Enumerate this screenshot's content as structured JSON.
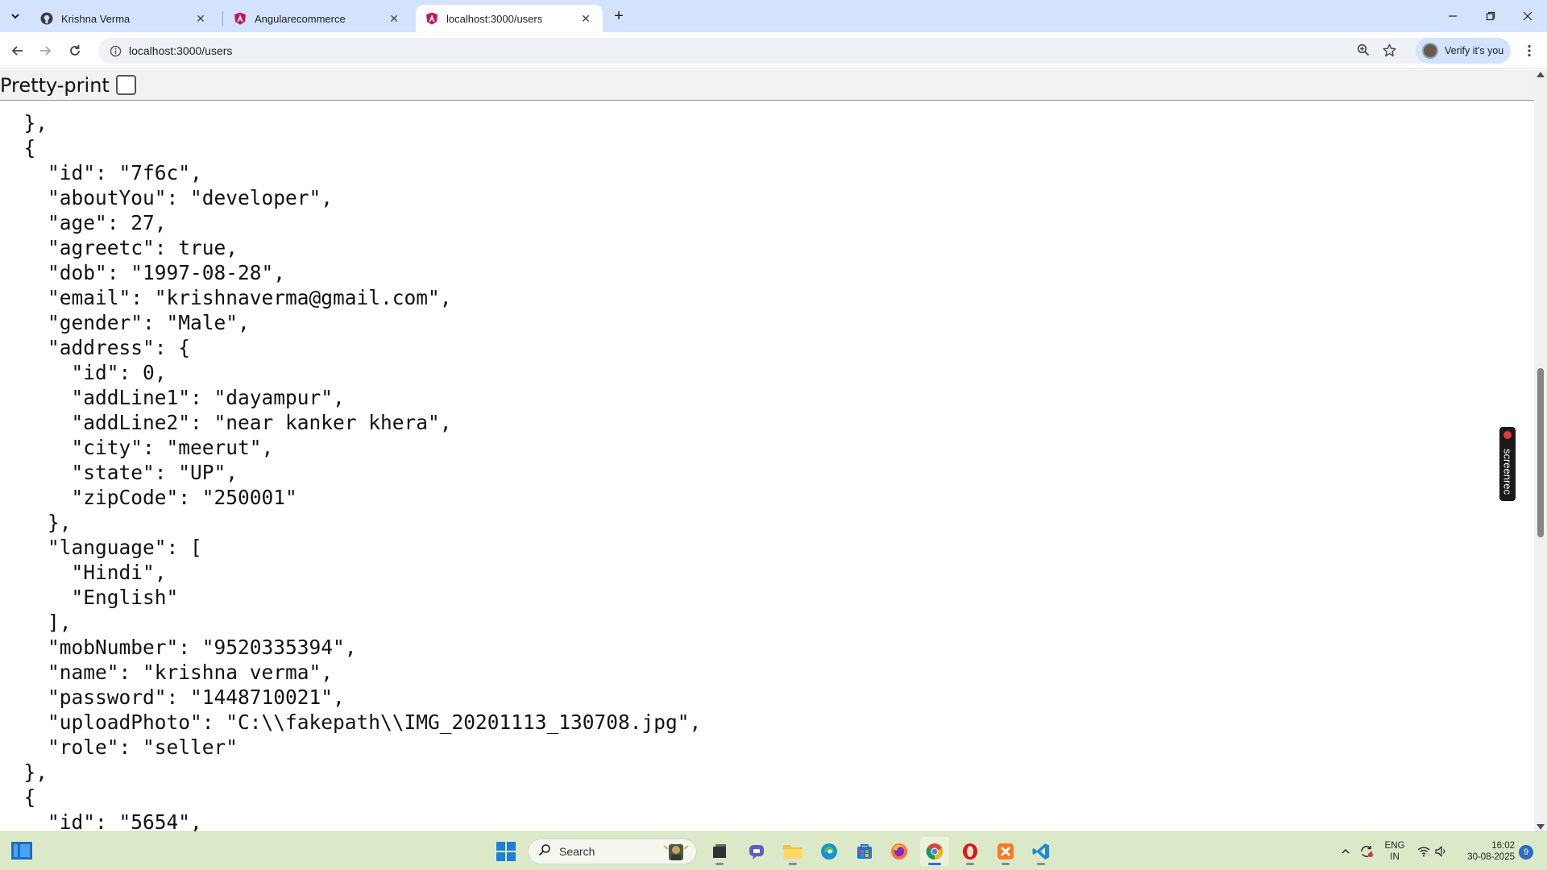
{
  "browser": {
    "tabs": [
      {
        "title": "Krishna Verma",
        "favicon": "github-icon",
        "active": false
      },
      {
        "title": "Angularecommerce",
        "favicon": "angular-icon",
        "active": false
      },
      {
        "title": "localhost:3000/users",
        "favicon": "angular-icon",
        "active": true
      }
    ],
    "url": "localhost:3000/users",
    "profile_label": "Verify it's you"
  },
  "page": {
    "pretty_print_label": "Pretty-print",
    "pretty_print_checked": false,
    "json_lines": [
      "  },",
      "  {",
      "    \"id\": \"7f6c\",",
      "    \"aboutYou\": \"developer\",",
      "    \"age\": 27,",
      "    \"agreetc\": true,",
      "    \"dob\": \"1997-08-28\",",
      "    \"email\": \"krishnaverma@gmail.com\",",
      "    \"gender\": \"Male\",",
      "    \"address\": {",
      "      \"id\": 0,",
      "      \"addLine1\": \"dayampur\",",
      "      \"addLine2\": \"near kanker khera\",",
      "      \"city\": \"meerut\",",
      "      \"state\": \"UP\",",
      "      \"zipCode\": \"250001\"",
      "    },",
      "    \"language\": [",
      "      \"Hindi\",",
      "      \"English\"",
      "    ],",
      "    \"mobNumber\": \"9520335394\",",
      "    \"name\": \"krishna verma\",",
      "    \"password\": \"1448710021\",",
      "    \"uploadPhoto\": \"C:\\\\fakepath\\\\IMG_20201113_130708.jpg\",",
      "    \"role\": \"seller\"",
      "  },",
      "  {",
      "    \"id\": \"5654\","
    ]
  },
  "overlay": {
    "screenrec_label": "screenrec"
  },
  "taskbar": {
    "search_label": "Search",
    "apps": [
      "file-explorer-icon",
      "teams-icon",
      "folder-icon",
      "edge-icon",
      "store-icon",
      "firefox-icon",
      "chrome-icon",
      "opera-icon",
      "xampp-icon",
      "vscode-icon"
    ],
    "lang_line1": "ENG",
    "lang_line2": "IN",
    "time": "16:02",
    "date": "30-08-2025",
    "notification_count": "9"
  },
  "colors": {
    "tabstrip_bg": "#d3e3fd",
    "taskbar_bg": "#dce9c9",
    "accent": "#1a73e8"
  }
}
